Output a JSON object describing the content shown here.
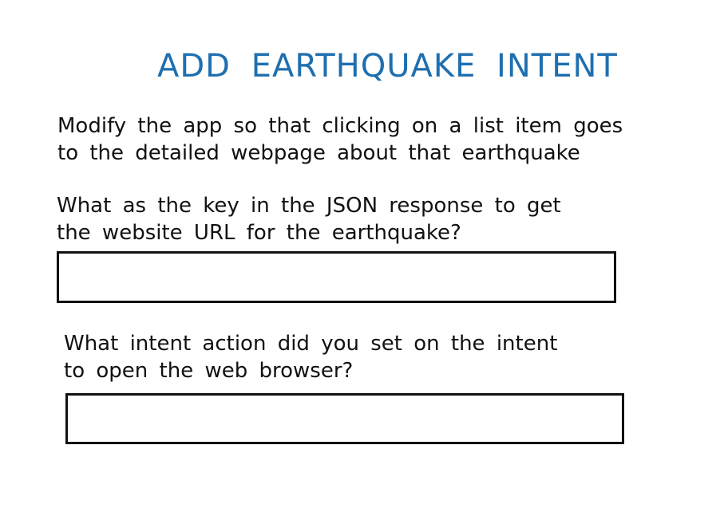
{
  "title": "ADD EARTHQUAKE INTENT",
  "instruction": {
    "line1": "Modify the app so that clicking on a list item goes",
    "line2": "to the detailed webpage about that earthquake"
  },
  "question1": {
    "line1": "What as the key in the JSON response to get",
    "line2": "the website URL for the earthquake?",
    "answer": ""
  },
  "question2": {
    "line1": "What intent action did you set on the intent",
    "line2": "to open the web browser?",
    "answer": ""
  },
  "colors": {
    "title": "#1e6fb0",
    "text": "#111111",
    "background": "#ffffff"
  }
}
